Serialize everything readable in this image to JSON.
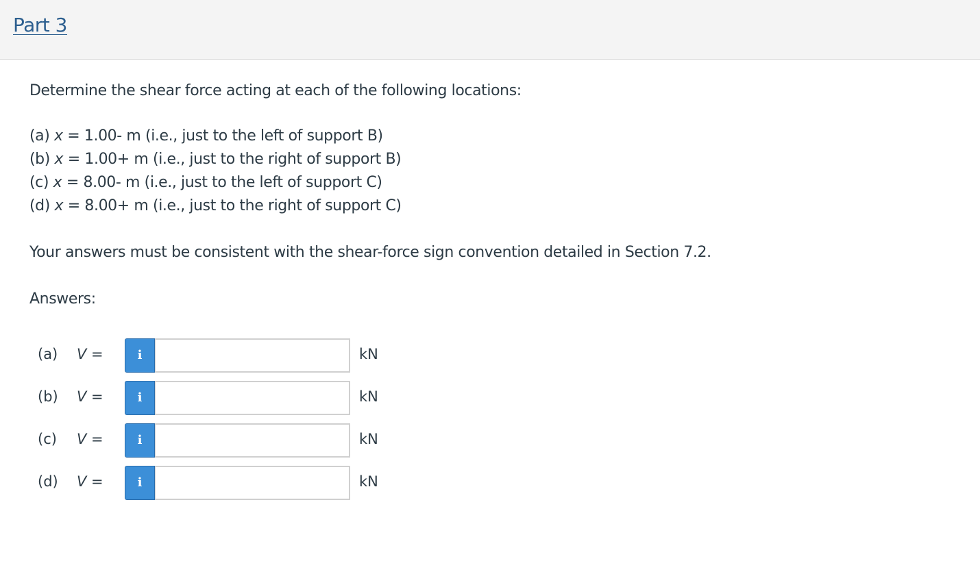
{
  "header": {
    "title": "Part 3"
  },
  "question": {
    "intro": "Determine the shear force acting at each of the following locations:",
    "cases": [
      {
        "prefix": "(a) ",
        "var": "x",
        "rest": " = 1.00- m (i.e., just to the left of support B)"
      },
      {
        "prefix": "(b) ",
        "var": "x",
        "rest": " = 1.00+ m (i.e., just to the right of support B)"
      },
      {
        "prefix": "(c) ",
        "var": "x",
        "rest": " = 8.00- m (i.e., just to the left of support C)"
      },
      {
        "prefix": "(d) ",
        "var": "x",
        "rest": " = 8.00+ m (i.e., just to the right of support C)"
      }
    ],
    "convention": "Your answers must be consistent with the shear-force sign convention detailed in Section 7.2.",
    "answers_label": "Answers:"
  },
  "answers": [
    {
      "label": "(a)",
      "var": "V",
      "eq": " =",
      "info_icon": "i",
      "value": "",
      "unit": "kN"
    },
    {
      "label": "(b)",
      "var": "V",
      "eq": " =",
      "info_icon": "i",
      "value": "",
      "unit": "kN"
    },
    {
      "label": "(c)",
      "var": "V",
      "eq": " =",
      "info_icon": "i",
      "value": "",
      "unit": "kN"
    },
    {
      "label": "(d)",
      "var": "V",
      "eq": " =",
      "info_icon": "i",
      "value": "",
      "unit": "kN"
    }
  ],
  "colors": {
    "link": "#2d5f8f",
    "info_button": "#3c8fd8",
    "header_bg": "#f4f4f4",
    "text": "#2d3b45"
  }
}
